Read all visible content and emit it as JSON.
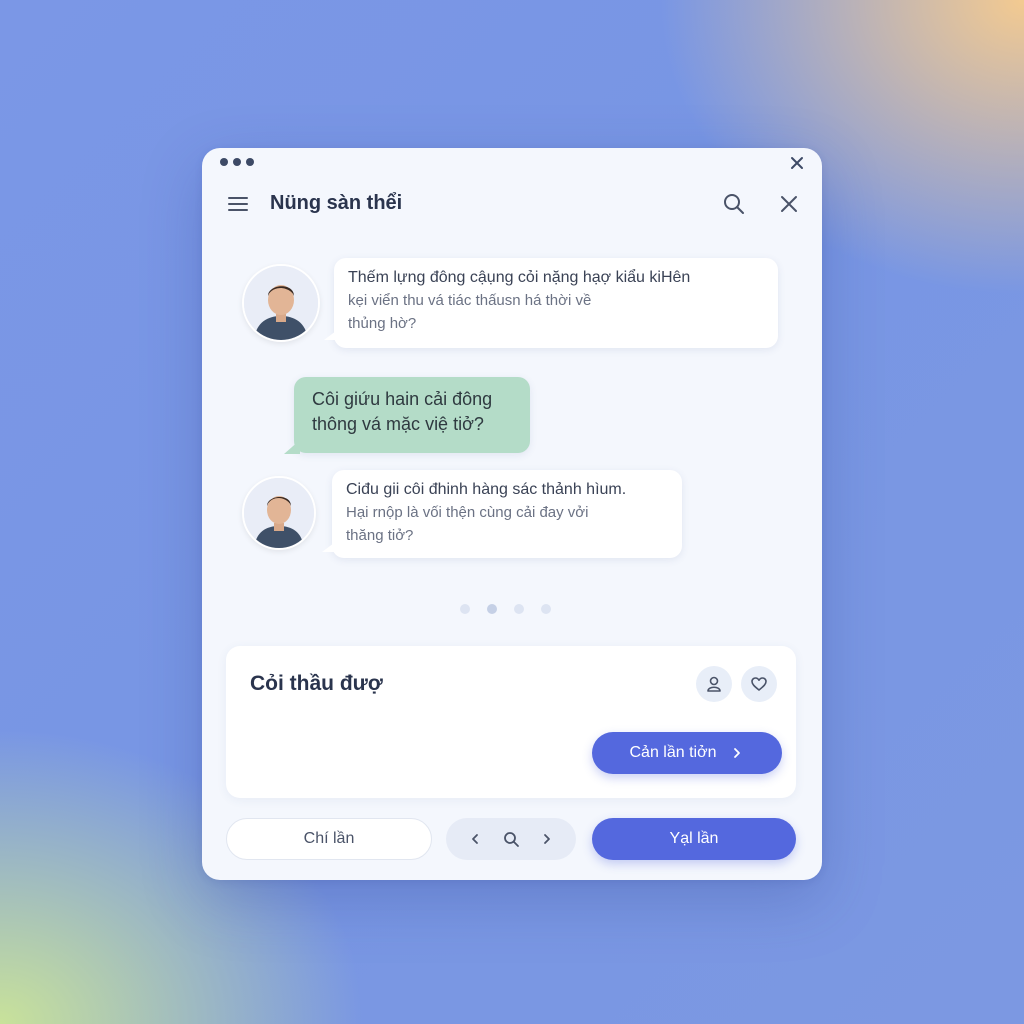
{
  "window": {
    "title": "Nüng sàn thểi"
  },
  "messages": [
    {
      "from": "incoming",
      "lines": [
        "Thếm lựng đông cậụng cỏi nặng hạợ kiẩu kiHên",
        "kẹi viển thu vá tiác thấusn há thời về",
        "thủng hờ?"
      ]
    },
    {
      "from": "outgoing",
      "lines": [
        "Côi giứu hain cải đông",
        "thông vá mặc việ tiở?"
      ]
    },
    {
      "from": "incoming",
      "lines": [
        "Ciđu gii côi đhinh hàng sác thảnh hìum.",
        "Hại rnộp là vối thện cùng cải đay vởi",
        "thăng tiở?"
      ]
    }
  ],
  "card": {
    "title": "Cỏi thầu đượ",
    "primary_label": "Cản lần tiởn"
  },
  "footer": {
    "ghost_label": "Chí lần",
    "primary_label": "Yạl lần"
  },
  "colors": {
    "accent": "#5468de",
    "outgoing_bubble": "#b4dcc8"
  },
  "icons": [
    "menu-icon",
    "search-icon",
    "close-icon",
    "user-icon",
    "heart-icon",
    "chevron-left-icon",
    "chevron-right-icon"
  ]
}
